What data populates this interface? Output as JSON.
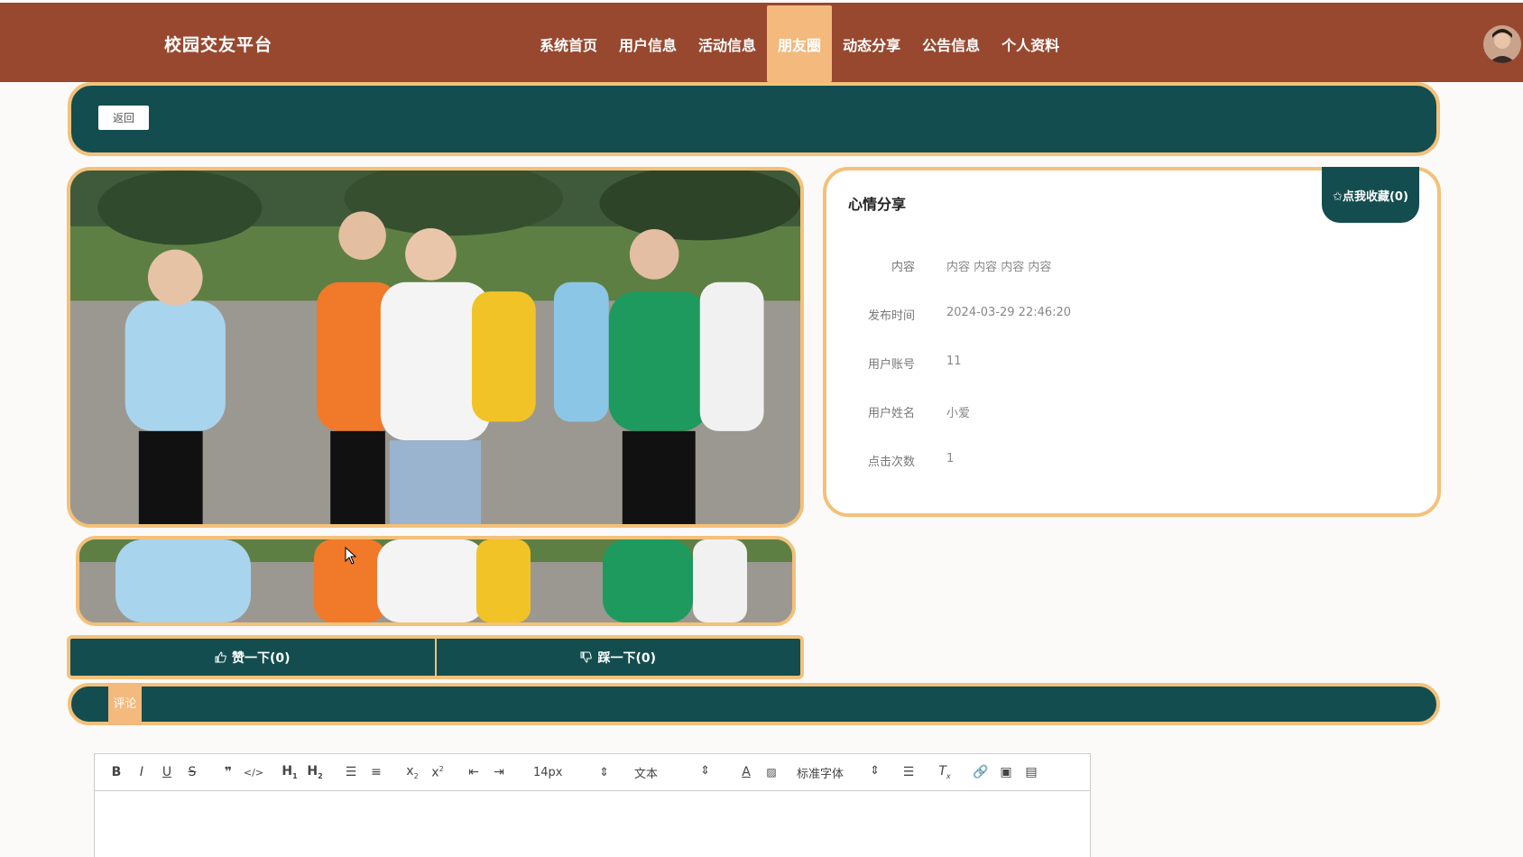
{
  "header": {
    "brand": "校园交友平台",
    "nav": [
      {
        "label": "系统首页",
        "active": false
      },
      {
        "label": "用户信息",
        "active": false
      },
      {
        "label": "活动信息",
        "active": false
      },
      {
        "label": "朋友圈",
        "active": true
      },
      {
        "label": "动态分享",
        "active": false
      },
      {
        "label": "公告信息",
        "active": false
      },
      {
        "label": "个人资料",
        "active": false
      }
    ]
  },
  "back_button": "返回",
  "post": {
    "title": "心情分享",
    "favorite_button": "✩点我收藏(0)",
    "fields": [
      {
        "label": "内容",
        "value": "内容 内容 内容 内容"
      },
      {
        "label": "发布时间",
        "value": "2024-03-29 22:46:20"
      },
      {
        "label": "用户账号",
        "value": "11"
      },
      {
        "label": "用户姓名",
        "value": "小爱"
      },
      {
        "label": "点击次数",
        "value": "1"
      }
    ]
  },
  "votes": {
    "like": "赞一下(0)",
    "dislike": "踩一下(0)"
  },
  "comment_tab": "评论",
  "editor": {
    "font_size": "14px",
    "block_type": "文本",
    "font_family": "标准字体"
  },
  "colors": {
    "header_bg": "#98482f",
    "teal": "#134d4f",
    "accent_gold": "#f3c17a",
    "active_tab": "#f3b97d"
  }
}
